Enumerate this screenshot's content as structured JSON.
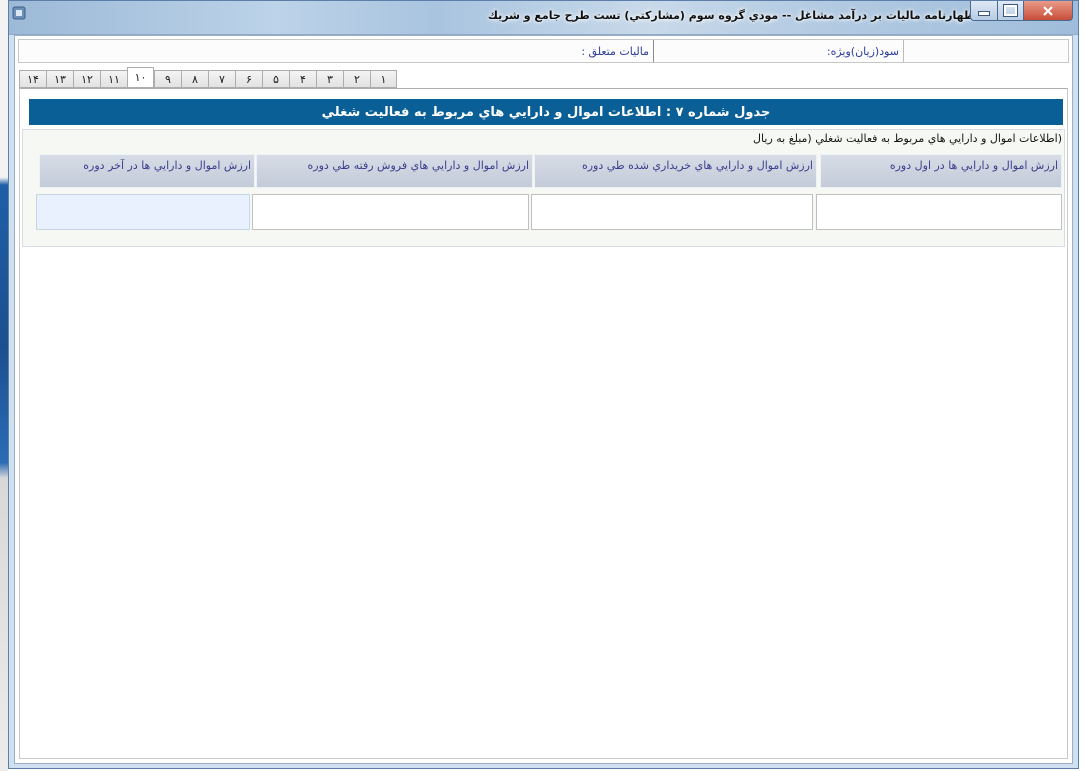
{
  "window": {
    "title": "اظهارنامه ماليات بر درآمد مشاغل -- مودي گروه سوم (مشاركتي)      تست طرح جامع و شريك",
    "accent": "#0a6096"
  },
  "infobar": {
    "empty": "",
    "profit_label": "سود(زيان)ويژه:",
    "tax_label": "ماليات متعلق :"
  },
  "tabs": [
    {
      "label": "۱"
    },
    {
      "label": "۲"
    },
    {
      "label": "۳"
    },
    {
      "label": "۴"
    },
    {
      "label": "۵"
    },
    {
      "label": "۶"
    },
    {
      "label": "۷"
    },
    {
      "label": "۸"
    },
    {
      "label": "۹"
    },
    {
      "label": "۱۰"
    },
    {
      "label": "۱۱"
    },
    {
      "label": "۱۲"
    },
    {
      "label": "۱۳"
    },
    {
      "label": "۱۴"
    }
  ],
  "active_tab": "۱۰",
  "section": {
    "title": "جدول شماره ۷ : اطلاعات اموال و دارايي هاي مربوط به فعاليت شغلي",
    "caption": "(اطلاعات اموال و دارايي هاي مربوط به فعاليت شغلي (مبلغ به ريال",
    "columns": [
      {
        "label": "ارزش اموال و دارايي ها در اول دوره",
        "value": ""
      },
      {
        "label": "ارزش اموال و دارايي هاي خريداري شده طي دوره",
        "value": ""
      },
      {
        "label": "ارزش اموال و دارايي هاي فروش رفته طي دوره",
        "value": ""
      },
      {
        "label": "ارزش اموال و دارايي ها در آخر دوره",
        "value": ""
      }
    ]
  }
}
